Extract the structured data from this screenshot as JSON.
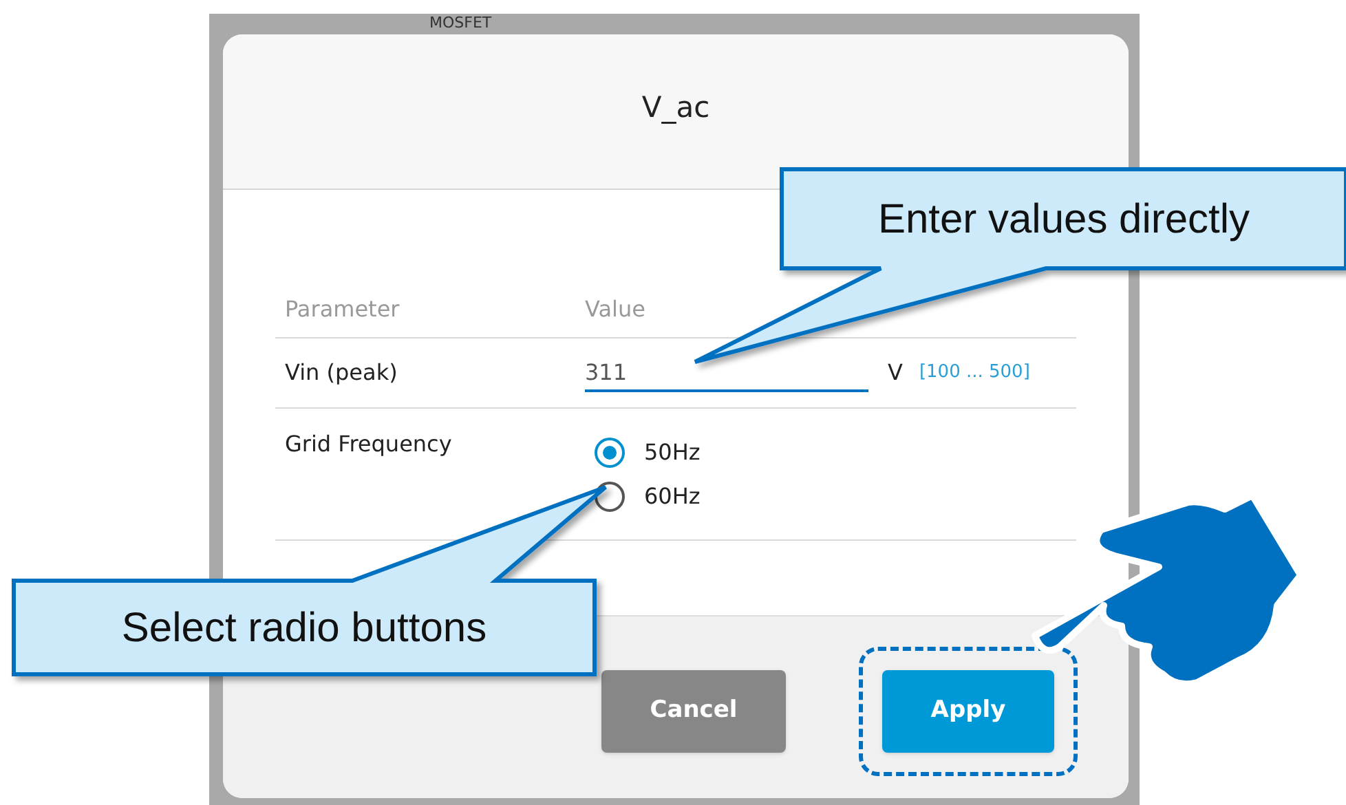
{
  "background": {
    "label": "MOSFET"
  },
  "dialog": {
    "title": "V_ac",
    "columns": [
      "Parameter",
      "Value"
    ],
    "rows": [
      {
        "kind": "input",
        "label": "Vin (peak)",
        "value": "311",
        "unit": "V",
        "range": "[100 ... 500]"
      },
      {
        "kind": "radio",
        "label": "Grid Frequency",
        "options": [
          {
            "label": "50Hz",
            "selected": true
          },
          {
            "label": "60Hz",
            "selected": false
          }
        ]
      }
    ],
    "buttons": [
      {
        "kind": "secondary",
        "label": "Cancel",
        "highlighted": false
      },
      {
        "kind": "primary",
        "label": "Apply",
        "highlighted": true
      }
    ]
  },
  "callouts": [
    {
      "kind": "top-right",
      "text": "Enter values directly"
    },
    {
      "kind": "bottom-left",
      "text": "Select radio buttons"
    }
  ]
}
